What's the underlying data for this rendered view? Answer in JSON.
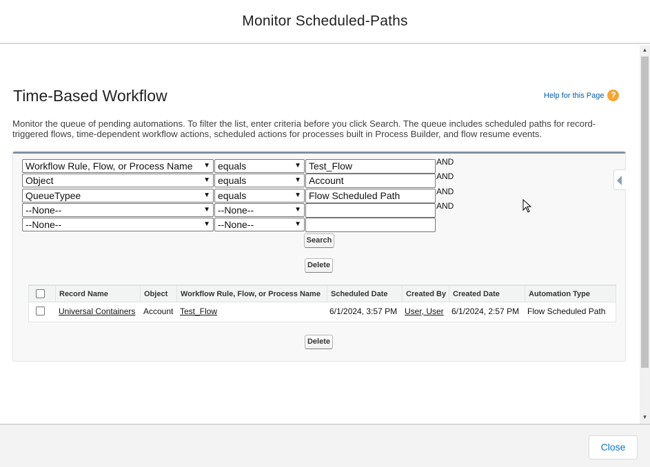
{
  "modal": {
    "title": "Monitor Scheduled-Paths",
    "close_label": "Close"
  },
  "page": {
    "title": "Time-Based Workflow",
    "help_link": "Help for this Page",
    "help_icon": "?",
    "description": "Monitor the queue of pending automations. To filter the list, enter criteria before you click Search. The queue includes scheduled paths for record-triggered flows, time-dependent workflow actions, scheduled actions for processes built in Process Builder, and flow resume events."
  },
  "filters": [
    {
      "field": "Workflow Rule, Flow, or Process Name",
      "operator": "equals",
      "value": "Test_Flow",
      "conjunction": "AND"
    },
    {
      "field": "Object",
      "operator": "equals",
      "value": "Account",
      "conjunction": "AND"
    },
    {
      "field": "QueueTypee",
      "operator": "equals",
      "value": "Flow Scheduled Path",
      "conjunction": "AND"
    },
    {
      "field": "--None--",
      "operator": "--None--",
      "value": "",
      "conjunction": "AND"
    },
    {
      "field": "--None--",
      "operator": "--None--",
      "value": "",
      "conjunction": ""
    }
  ],
  "buttons": {
    "search": "Search",
    "delete_top": "Delete",
    "delete_bottom": "Delete"
  },
  "table": {
    "headers": [
      "Record Name",
      "Object",
      "Workflow Rule, Flow, or Process Name",
      "Scheduled Date",
      "Created By",
      "Created Date",
      "Automation Type"
    ],
    "rows": [
      {
        "record_name": "Universal Containers",
        "object": "Account",
        "workflow": "Test_Flow",
        "scheduled_date": "6/1/2024, 3:57 PM",
        "created_by": "User, User",
        "created_date": "6/1/2024, 2:57 PM",
        "automation_type": "Flow Scheduled Path"
      }
    ]
  },
  "colors": {
    "link": "#015ba7",
    "close_text": "#0176d3",
    "help_icon": "#f3a536",
    "filter_border_top": "#7f8fa4"
  },
  "icons": {
    "help": "help-icon",
    "dropdown": "chevron-down-icon",
    "side_tab": "collapse-arrow-icon",
    "cursor": "mouse-pointer-icon"
  }
}
